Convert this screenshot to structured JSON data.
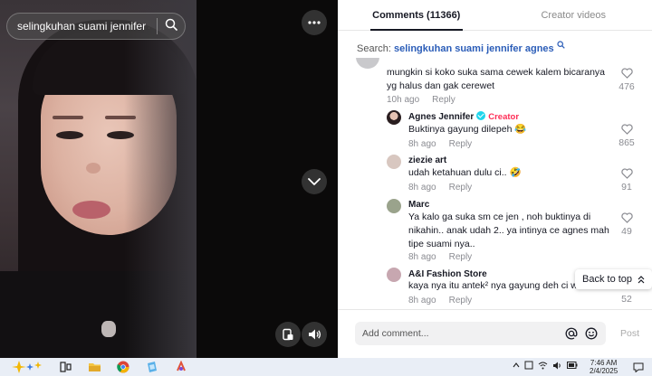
{
  "video": {
    "search_query": "selingkuhan suami jennifer ag..."
  },
  "tabs": [
    {
      "label": "Comments (11366)",
      "active": true
    },
    {
      "label": "Creator videos",
      "active": false
    }
  ],
  "search": {
    "prefix": "Search:",
    "keyword": "selingkuhan suami jennifer agnes"
  },
  "comments": [
    {
      "user": "",
      "text": "mungkin si koko suka sama cewek kalem bicaranya yg halus dan gak cerewet",
      "time": "10h ago",
      "reply": "Reply",
      "likes": "476"
    },
    {
      "user": "Agnes Jennifer",
      "badge": "Creator",
      "text": "Buktinya gayung dilepeh 😂",
      "time": "8h ago",
      "reply": "Reply",
      "likes": "865"
    },
    {
      "user": "ziezie art",
      "text": "udah ketahuan dulu ci.. 🤣",
      "time": "8h ago",
      "reply": "Reply",
      "likes": "91"
    },
    {
      "user": "Marc",
      "text": "Ya kalo ga suka sm ce jen , noh buktinya di nikahin.. anak udah 2.. ya intinya ce agnes mah tipe suami nya..",
      "time": "8h ago",
      "reply": "Reply",
      "likes": "49"
    },
    {
      "user": "A&I Fashion Store",
      "text": "kaya nya itu antek² nya gayung deh ci wkwk",
      "time": "8h ago",
      "reply": "Reply",
      "likes": "52"
    }
  ],
  "back_to_top": "Back to top",
  "add_comment": {
    "placeholder": "Add comment...",
    "post_label": "Post"
  },
  "taskbar": {
    "time": "7:46 AM",
    "date": "2/4/2025"
  },
  "colors": {
    "accent_blue": "#2b5db8",
    "creator_red": "#fe2c55",
    "verified": "#20d5ec"
  }
}
